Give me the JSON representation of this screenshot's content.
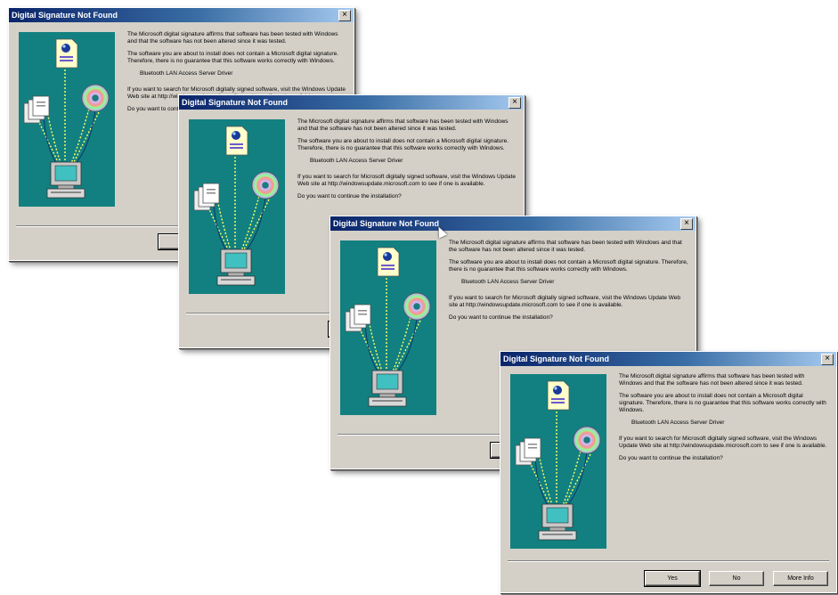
{
  "dialog": {
    "title": "Digital Signature Not Found",
    "close_glyph": "×",
    "para1": "The Microsoft digital signature affirms that software has been tested with Windows and that the software has not been altered since it was tested.",
    "para2": "The software you are about to install does not contain a Microsoft digital signature. Therefore, there is no guarantee that this software works correctly with Windows.",
    "driver": "Bluetooth LAN Access Server Driver",
    "para3": "If you want to search for Microsoft digitally signed software, visit the Windows Update Web site at http://windowsupdate.microsoft.com to see if one is available.",
    "question": "Do you want to continue the installation?",
    "buttons": {
      "yes": "Yes",
      "no": "No",
      "more_info": "More Info"
    }
  },
  "colors": {
    "titlebar": "#0a246a",
    "banner": "#128080",
    "face": "#d4d0c8"
  },
  "icons": [
    "document-icon",
    "stacked-pages-icon",
    "cd-disc-icon",
    "computer-monitor-icon",
    "close-icon",
    "mouse-cursor-icon"
  ]
}
